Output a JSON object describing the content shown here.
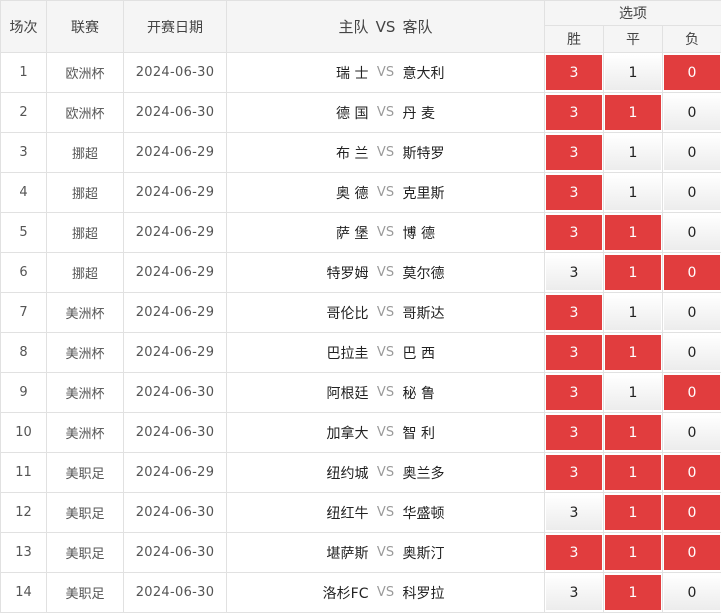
{
  "header": {
    "no": "场次",
    "league": "联赛",
    "date": "开赛日期",
    "home": "主队",
    "vs": "VS",
    "away": "客队",
    "options": "选项",
    "win": "胜",
    "draw": "平",
    "lose": "负"
  },
  "colors": {
    "selected": "#e13d3e",
    "border": "#e1e1e1",
    "header_bg": "#f5f5f5"
  },
  "rows": [
    {
      "no": "1",
      "league": "欧洲杯",
      "date": "2024-06-30",
      "home": "瑞 士",
      "vs": "VS",
      "away": "意大利",
      "win": "3",
      "draw": "1",
      "lose": "0",
      "sel": [
        true,
        false,
        true
      ]
    },
    {
      "no": "2",
      "league": "欧洲杯",
      "date": "2024-06-30",
      "home": "德 国",
      "vs": "VS",
      "away": "丹 麦",
      "win": "3",
      "draw": "1",
      "lose": "0",
      "sel": [
        true,
        true,
        false
      ]
    },
    {
      "no": "3",
      "league": "挪超",
      "date": "2024-06-29",
      "home": "布 兰",
      "vs": "VS",
      "away": "斯特罗",
      "win": "3",
      "draw": "1",
      "lose": "0",
      "sel": [
        true,
        false,
        false
      ]
    },
    {
      "no": "4",
      "league": "挪超",
      "date": "2024-06-29",
      "home": "奥 德",
      "vs": "VS",
      "away": "克里斯",
      "win": "3",
      "draw": "1",
      "lose": "0",
      "sel": [
        true,
        false,
        false
      ]
    },
    {
      "no": "5",
      "league": "挪超",
      "date": "2024-06-29",
      "home": "萨 堡",
      "vs": "VS",
      "away": "博 德",
      "win": "3",
      "draw": "1",
      "lose": "0",
      "sel": [
        true,
        true,
        false
      ]
    },
    {
      "no": "6",
      "league": "挪超",
      "date": "2024-06-29",
      "home": "特罗姆",
      "vs": "VS",
      "away": "莫尔德",
      "win": "3",
      "draw": "1",
      "lose": "0",
      "sel": [
        false,
        true,
        true
      ]
    },
    {
      "no": "7",
      "league": "美洲杯",
      "date": "2024-06-29",
      "home": "哥伦比",
      "vs": "VS",
      "away": "哥斯达",
      "win": "3",
      "draw": "1",
      "lose": "0",
      "sel": [
        true,
        false,
        false
      ]
    },
    {
      "no": "8",
      "league": "美洲杯",
      "date": "2024-06-29",
      "home": "巴拉圭",
      "vs": "VS",
      "away": "巴 西",
      "win": "3",
      "draw": "1",
      "lose": "0",
      "sel": [
        true,
        true,
        false
      ]
    },
    {
      "no": "9",
      "league": "美洲杯",
      "date": "2024-06-30",
      "home": "阿根廷",
      "vs": "VS",
      "away": "秘 鲁",
      "win": "3",
      "draw": "1",
      "lose": "0",
      "sel": [
        true,
        false,
        true
      ]
    },
    {
      "no": "10",
      "league": "美洲杯",
      "date": "2024-06-30",
      "home": "加拿大",
      "vs": "VS",
      "away": "智 利",
      "win": "3",
      "draw": "1",
      "lose": "0",
      "sel": [
        true,
        true,
        false
      ]
    },
    {
      "no": "11",
      "league": "美职足",
      "date": "2024-06-29",
      "home": "纽约城",
      "vs": "VS",
      "away": "奥兰多",
      "win": "3",
      "draw": "1",
      "lose": "0",
      "sel": [
        true,
        true,
        true
      ]
    },
    {
      "no": "12",
      "league": "美职足",
      "date": "2024-06-30",
      "home": "纽红牛",
      "vs": "VS",
      "away": "华盛顿",
      "win": "3",
      "draw": "1",
      "lose": "0",
      "sel": [
        false,
        true,
        true
      ]
    },
    {
      "no": "13",
      "league": "美职足",
      "date": "2024-06-30",
      "home": "堪萨斯",
      "vs": "VS",
      "away": "奥斯汀",
      "win": "3",
      "draw": "1",
      "lose": "0",
      "sel": [
        true,
        true,
        true
      ]
    },
    {
      "no": "14",
      "league": "美职足",
      "date": "2024-06-30",
      "home": "洛杉FC",
      "vs": "VS",
      "away": "科罗拉",
      "win": "3",
      "draw": "1",
      "lose": "0",
      "sel": [
        false,
        true,
        false
      ]
    }
  ]
}
